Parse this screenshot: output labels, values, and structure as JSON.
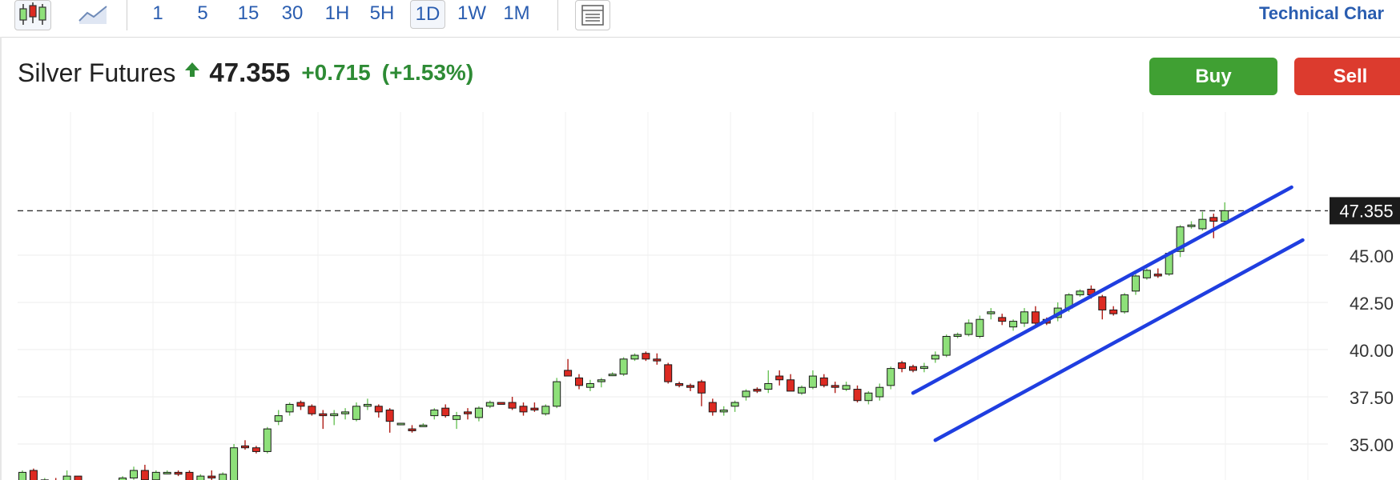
{
  "toolbar": {
    "intervals": [
      "1",
      "5",
      "15",
      "30",
      "1H",
      "5H",
      "1D",
      "1W",
      "1M"
    ],
    "active_interval": "1D",
    "right_label": "Technical Char"
  },
  "instrument": {
    "name": "Silver Futures",
    "price": "47.355",
    "change": "+0.715",
    "change_pct": "(+1.53%)"
  },
  "actions": {
    "buy": "Buy",
    "sell": "Sell"
  },
  "colors": {
    "up": "#8ee07a",
    "down": "#dd2a22",
    "trend": "#1f3ee0",
    "accent": "#2a5db0",
    "buy": "#40a033",
    "sell": "#dc3b2e"
  },
  "chart_data": {
    "type": "candlestick",
    "title": "Silver Futures",
    "x": "daily sessions (1D)",
    "ylim": [
      32.2,
      49.3
    ],
    "yticks": [
      "35.00",
      "37.50",
      "40.00",
      "42.50",
      "45.00"
    ],
    "last_price_label": "47.355",
    "ohlc": [
      [
        33.0,
        33.6,
        32.8,
        33.5
      ],
      [
        33.6,
        33.7,
        32.8,
        32.9
      ],
      [
        32.9,
        33.2,
        32.6,
        33.1
      ],
      [
        33.0,
        33.2,
        32.7,
        32.9
      ],
      [
        32.9,
        33.6,
        32.8,
        33.3
      ],
      [
        33.3,
        33.3,
        32.6,
        32.7
      ],
      [
        32.7,
        33.0,
        32.5,
        32.9
      ],
      [
        32.8,
        32.9,
        32.3,
        32.6
      ],
      [
        32.6,
        32.9,
        32.2,
        32.5
      ],
      [
        32.5,
        33.3,
        32.4,
        33.2
      ],
      [
        33.2,
        33.8,
        33.1,
        33.6
      ],
      [
        33.6,
        33.9,
        33.0,
        33.1
      ],
      [
        33.1,
        33.6,
        33.0,
        33.5
      ],
      [
        33.5,
        33.6,
        33.4,
        33.5
      ],
      [
        33.5,
        33.6,
        33.3,
        33.4
      ],
      [
        33.5,
        33.6,
        32.9,
        33.0
      ],
      [
        33.0,
        33.4,
        32.8,
        33.3
      ],
      [
        33.3,
        33.6,
        32.9,
        33.2
      ],
      [
        32.9,
        33.5,
        32.8,
        33.4
      ],
      [
        33.0,
        35.0,
        32.9,
        34.8
      ],
      [
        34.9,
        35.2,
        34.7,
        34.8
      ],
      [
        34.8,
        34.9,
        34.5,
        34.6
      ],
      [
        34.6,
        35.9,
        34.5,
        35.8
      ],
      [
        36.2,
        36.8,
        36.0,
        36.5
      ],
      [
        36.7,
        37.2,
        36.5,
        37.1
      ],
      [
        37.2,
        37.3,
        36.8,
        37.0
      ],
      [
        37.0,
        37.1,
        36.5,
        36.6
      ],
      [
        36.6,
        36.8,
        35.8,
        36.5
      ],
      [
        36.5,
        36.8,
        36.0,
        36.6
      ],
      [
        36.6,
        36.9,
        36.3,
        36.7
      ],
      [
        36.3,
        37.2,
        36.2,
        37.0
      ],
      [
        37.0,
        37.4,
        36.8,
        37.1
      ],
      [
        37.0,
        37.1,
        36.4,
        36.7
      ],
      [
        36.8,
        36.9,
        35.6,
        36.2
      ],
      [
        36.1,
        36.1,
        36.1,
        36.1
      ],
      [
        35.8,
        36.0,
        35.6,
        35.7
      ],
      [
        36.0,
        36.1,
        36.0,
        36.0
      ],
      [
        36.5,
        36.9,
        36.3,
        36.8
      ],
      [
        36.9,
        37.1,
        36.4,
        36.5
      ],
      [
        36.3,
        36.7,
        35.8,
        36.5
      ],
      [
        36.7,
        36.9,
        36.3,
        36.6
      ],
      [
        36.4,
        37.0,
        36.2,
        36.9
      ],
      [
        37.0,
        37.3,
        36.9,
        37.2
      ],
      [
        37.2,
        37.2,
        37.1,
        37.1
      ],
      [
        37.2,
        37.5,
        36.8,
        36.9
      ],
      [
        37.0,
        37.2,
        36.5,
        36.7
      ],
      [
        36.9,
        37.2,
        36.7,
        36.8
      ],
      [
        36.6,
        37.1,
        36.5,
        37.0
      ],
      [
        37.0,
        38.5,
        36.9,
        38.3
      ],
      [
        38.9,
        39.5,
        38.6,
        38.6
      ],
      [
        38.5,
        38.7,
        37.9,
        38.1
      ],
      [
        38.0,
        38.4,
        37.8,
        38.2
      ],
      [
        38.3,
        38.5,
        38.0,
        38.4
      ],
      [
        38.7,
        38.8,
        38.6,
        38.7
      ],
      [
        38.7,
        39.6,
        38.6,
        39.5
      ],
      [
        39.5,
        39.8,
        39.4,
        39.7
      ],
      [
        39.8,
        39.9,
        39.4,
        39.5
      ],
      [
        39.5,
        39.8,
        39.2,
        39.4
      ],
      [
        39.2,
        39.3,
        38.2,
        38.3
      ],
      [
        38.2,
        38.3,
        38.0,
        38.1
      ],
      [
        38.1,
        38.2,
        37.8,
        38.0
      ],
      [
        38.3,
        38.4,
        37.0,
        37.7
      ],
      [
        37.2,
        37.4,
        36.5,
        36.7
      ],
      [
        36.7,
        37.0,
        36.5,
        36.8
      ],
      [
        37.0,
        37.3,
        36.7,
        37.2
      ],
      [
        37.5,
        37.9,
        37.3,
        37.8
      ],
      [
        37.9,
        38.0,
        37.7,
        37.8
      ],
      [
        37.9,
        38.9,
        37.7,
        38.2
      ],
      [
        38.6,
        38.9,
        38.1,
        38.4
      ],
      [
        38.4,
        38.7,
        37.8,
        37.8
      ],
      [
        37.7,
        38.1,
        37.6,
        38.0
      ],
      [
        38.0,
        38.9,
        37.9,
        38.6
      ],
      [
        38.5,
        38.7,
        38.0,
        38.1
      ],
      [
        38.1,
        38.3,
        37.7,
        38.0
      ],
      [
        37.9,
        38.3,
        37.8,
        38.1
      ],
      [
        37.9,
        38.1,
        37.2,
        37.3
      ],
      [
        37.3,
        37.8,
        37.1,
        37.7
      ],
      [
        37.5,
        38.2,
        37.3,
        38.0
      ],
      [
        38.1,
        39.1,
        37.9,
        39.0
      ],
      [
        39.3,
        39.4,
        38.8,
        39.0
      ],
      [
        39.1,
        39.2,
        38.8,
        38.9
      ],
      [
        39.0,
        39.3,
        38.8,
        39.1
      ],
      [
        39.5,
        39.9,
        39.3,
        39.7
      ],
      [
        39.7,
        40.8,
        39.6,
        40.7
      ],
      [
        40.7,
        40.9,
        40.6,
        40.8
      ],
      [
        40.8,
        41.6,
        40.7,
        41.4
      ],
      [
        40.7,
        41.8,
        40.6,
        41.6
      ],
      [
        41.9,
        42.2,
        41.6,
        42.0
      ],
      [
        41.7,
        41.9,
        41.3,
        41.5
      ],
      [
        41.2,
        41.6,
        41.0,
        41.5
      ],
      [
        41.4,
        42.2,
        41.2,
        42.0
      ],
      [
        42.0,
        42.3,
        41.2,
        41.4
      ],
      [
        41.6,
        41.7,
        41.3,
        41.4
      ],
      [
        41.7,
        42.5,
        41.5,
        42.2
      ],
      [
        42.2,
        43.0,
        42.0,
        42.9
      ],
      [
        42.9,
        43.2,
        42.8,
        43.1
      ],
      [
        43.2,
        43.4,
        42.7,
        42.9
      ],
      [
        42.8,
        42.9,
        41.6,
        42.1
      ],
      [
        42.1,
        42.3,
        41.8,
        41.9
      ],
      [
        42.0,
        43.0,
        41.9,
        42.9
      ],
      [
        43.1,
        44.0,
        42.9,
        43.9
      ],
      [
        43.8,
        44.3,
        43.7,
        44.2
      ],
      [
        44.0,
        44.3,
        43.8,
        43.9
      ],
      [
        44.0,
        45.2,
        43.9,
        45.1
      ],
      [
        45.2,
        46.6,
        44.9,
        46.5
      ],
      [
        46.6,
        46.8,
        46.4,
        46.6
      ],
      [
        46.4,
        47.3,
        46.3,
        46.9
      ],
      [
        47.0,
        47.2,
        45.9,
        46.8
      ],
      [
        46.8,
        47.8,
        46.7,
        47.355
      ]
    ],
    "channel": {
      "upper": [
        [
          80,
          37.7
        ],
        [
          114,
          48.6
        ]
      ],
      "lower": [
        [
          82,
          35.2
        ],
        [
          115,
          45.8
        ]
      ]
    }
  }
}
